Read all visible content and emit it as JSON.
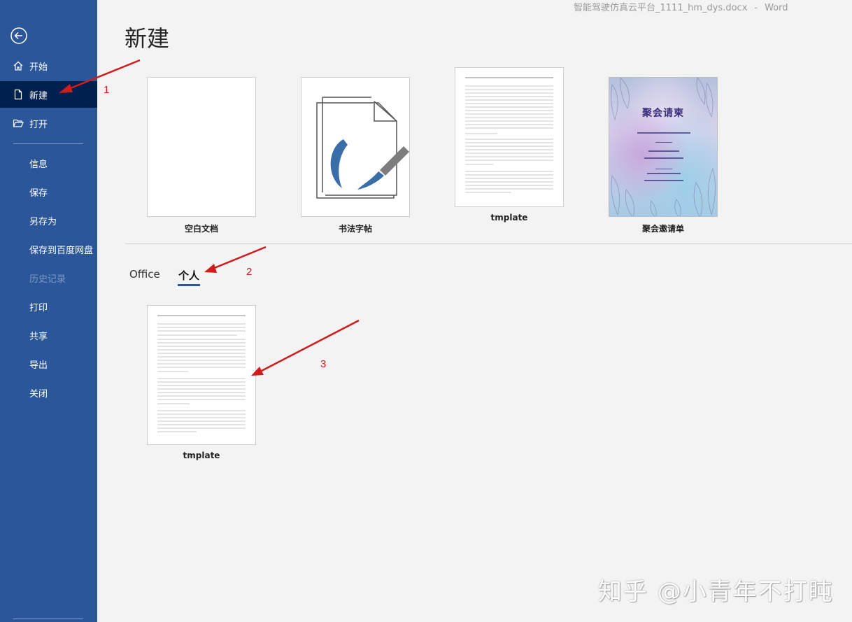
{
  "window": {
    "file_name": "智能驾驶仿真云平台_1111_hm_dys.docx",
    "separator": "-",
    "app_name": "Word"
  },
  "sidebar": {
    "items": [
      {
        "label": "开始",
        "icon": "home-icon"
      },
      {
        "label": "新建",
        "icon": "new-document-icon",
        "active": true
      },
      {
        "label": "打开",
        "icon": "open-folder-icon"
      },
      {
        "label": "信息"
      },
      {
        "label": "保存"
      },
      {
        "label": "另存为"
      },
      {
        "label": "保存到百度网盘"
      },
      {
        "label": "历史记录",
        "disabled": true
      },
      {
        "label": "打印"
      },
      {
        "label": "共享"
      },
      {
        "label": "导出"
      },
      {
        "label": "关闭"
      }
    ]
  },
  "main": {
    "title": "新建",
    "templates": [
      {
        "caption": "空白文档"
      },
      {
        "caption": "书法字帖"
      },
      {
        "caption": "tmplate"
      },
      {
        "caption": "聚会邀请单",
        "thumb_title": "聚会请柬"
      }
    ],
    "tabs": [
      {
        "label": "Office"
      },
      {
        "label": "个人",
        "selected": true
      }
    ],
    "personal_templates": [
      {
        "caption": "tmplate"
      }
    ]
  },
  "annotations": {
    "labels": [
      "1",
      "2",
      "3"
    ],
    "color": "#d01c1c"
  },
  "watermark": "知乎 @小青年不打盹",
  "colors": {
    "sidebar": "#2b579a",
    "sidebar_active": "#002050",
    "background": "#f3f3f3"
  }
}
